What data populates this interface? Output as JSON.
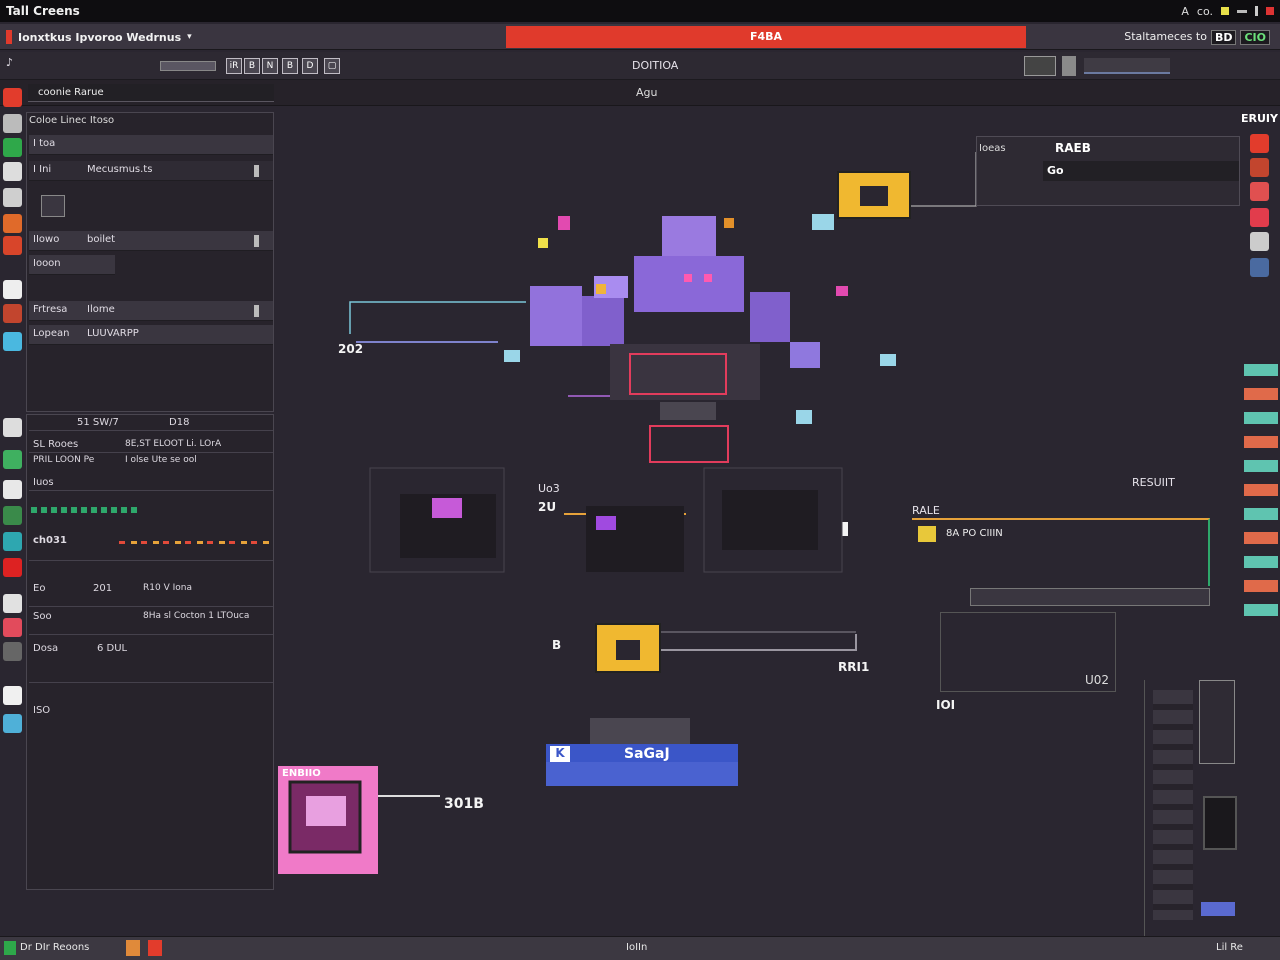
{
  "window": {
    "title": "Tall Creens",
    "tray": [
      "A",
      "co."
    ]
  },
  "header": {
    "app_title": "Ionxtkus Ipvoroo Wedrnus",
    "banner": "F4BA",
    "right_text": "Staltameces to",
    "badges": [
      "BD",
      "CIO"
    ]
  },
  "toolbar": {
    "center_label": "DOITIOA",
    "buttons": [
      "iR",
      "B",
      "N",
      "B",
      "D"
    ]
  },
  "row2": {
    "field": "coonie Rarue",
    "center": "Agu"
  },
  "left_panel": {
    "header": "Coloe Linec Itoso",
    "rows": [
      {
        "k": "I toa",
        "v": ""
      },
      {
        "k": "I Ini",
        "v": "Mecusmus.ts"
      },
      {
        "k": "IIowo",
        "v": "boilet"
      },
      {
        "k": "Iooon",
        "v": ""
      },
      {
        "k": "Frtresa",
        "v": "Ilome"
      },
      {
        "k": "Lopean",
        "v": "LUUVARPP"
      }
    ]
  },
  "left_panel2": {
    "header_a": "51 SW/7",
    "header_b": "D18",
    "rows": [
      {
        "a": "SL Rooes",
        "b": "8E,ST ELOOT Li. LOrA"
      },
      {
        "a": "PRIL LOON Pe",
        "b": "I olse Ute se ool"
      },
      {
        "a": "Iuos",
        "b": ""
      },
      {
        "a": "ch031",
        "b": ""
      },
      {
        "a": "Eo",
        "b": "R10 V Iona",
        "c": "201"
      },
      {
        "a": "Soo",
        "b": "8Ha sl Cocton 1 LTOuca"
      },
      {
        "a": "Dosa",
        "b": "6 DUL"
      },
      {
        "a": "ISO",
        "b": ""
      }
    ]
  },
  "canvas": {
    "labels": [
      "202",
      "Uo3",
      "2U",
      "B",
      "RRI1",
      "RAEB",
      "RALE",
      "RESUIIT",
      "8A PO CIIIN",
      "U02",
      "IOI"
    ],
    "button": "SaGaJ",
    "pink_caption": "ENBIIO",
    "pink_value": "301B",
    "right_panel_title": "RAEB",
    "right_panel_key": "Ioeas",
    "right_panel_value": "Go",
    "side_head": "ERUIY"
  },
  "status": {
    "left": "Dr DIr Reoons",
    "center": "IoIIn",
    "right": "Lil Re"
  }
}
